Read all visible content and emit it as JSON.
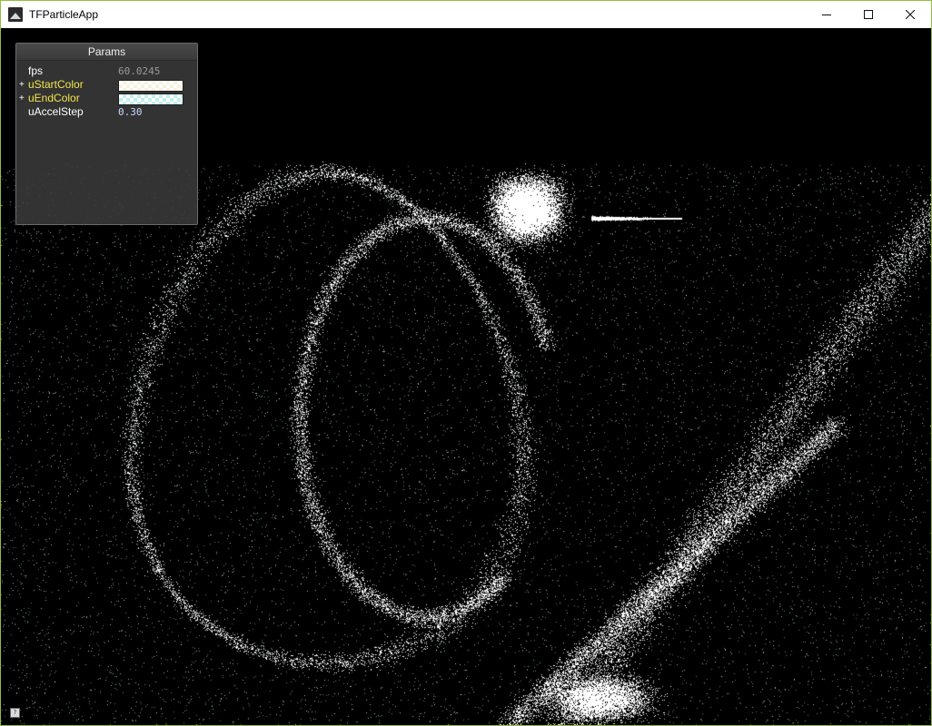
{
  "window": {
    "title": "TFParticleApp",
    "app_icon": "app-mountain-icon",
    "controls": {
      "minimize": "minimize-icon",
      "maximize": "maximize-icon",
      "close": "close-icon"
    }
  },
  "params": {
    "title": "Params",
    "rows": [
      {
        "label": "fps",
        "value": "60.0245"
      },
      {
        "label": "uStartColor",
        "color": "#f7f2dd"
      },
      {
        "label": "uEndColor",
        "color": "#bfefef"
      },
      {
        "label": "uAccelStep",
        "value": "0.30"
      }
    ]
  },
  "help_icon": "?",
  "colors": {
    "particle_start": "#f7f2dd",
    "particle_end": "#a9eef0",
    "background": "#000000",
    "label_yellow": "#f2e64a"
  }
}
